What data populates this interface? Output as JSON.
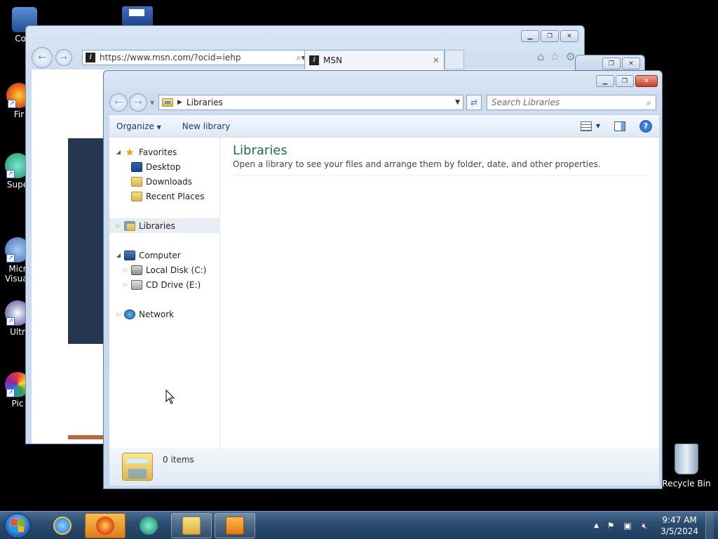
{
  "desktop": {
    "icons": [
      {
        "label": "Com",
        "icon": "computer-icon"
      },
      {
        "label": "Fir",
        "icon": "firefox-icon"
      },
      {
        "label": "Supe",
        "icon": "app-icon"
      },
      {
        "label": "Micr",
        "label2": "Visual",
        "icon": "visual-studio-icon"
      },
      {
        "label": "Ultr",
        "icon": "disc-icon"
      },
      {
        "label": "Pic",
        "icon": "picture-app-icon"
      }
    ],
    "recycle_bin": "Recycle Bin"
  },
  "ie_window": {
    "url": "https://www.msn.com/?ocid=iehp",
    "tab_title": "MSN",
    "site_icon": "msn-icon"
  },
  "explorer": {
    "address": "Libraries",
    "search_placeholder": "Search Libraries",
    "toolbar": {
      "organize": "Organize",
      "new_library": "New library"
    },
    "nav": {
      "favorites": "Favorites",
      "desktop": "Desktop",
      "downloads": "Downloads",
      "recent_places": "Recent Places",
      "libraries": "Libraries",
      "computer": "Computer",
      "local_disk": "Local Disk (C:)",
      "cd_drive": "CD Drive (E:)",
      "network": "Network"
    },
    "content": {
      "title": "Libraries",
      "description": "Open a library to see your files and arrange them by folder, date, and other properties."
    },
    "status": {
      "items": "0 items"
    }
  },
  "taskbar": {
    "apps": [
      "internet-explorer-icon",
      "firefox-icon",
      "app-icon",
      "file-explorer-icon",
      "media-player-icon"
    ],
    "clock_time": "9:47 AM",
    "clock_date": "3/5/2024"
  },
  "colors": {
    "library_title": "#1e7145",
    "taskbar": "#2c4d70",
    "desktop_bg": "#000000"
  }
}
